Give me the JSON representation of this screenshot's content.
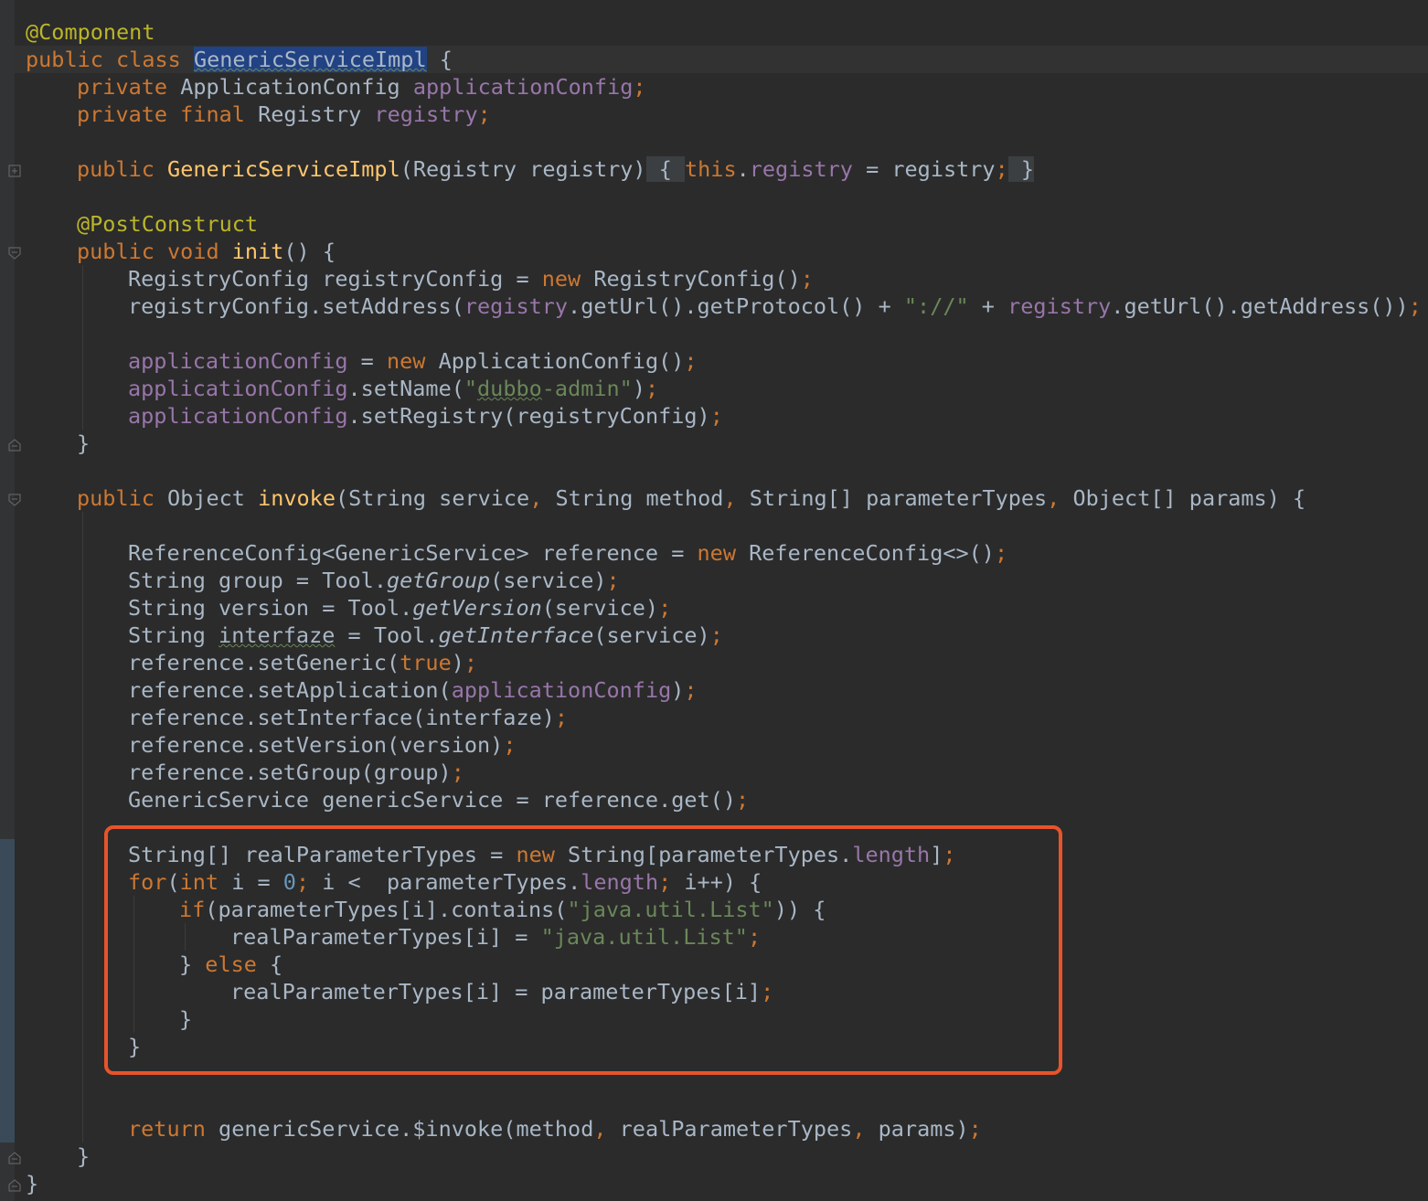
{
  "editor": {
    "lines": {
      "l1_annotation": "@Component",
      "l2_public_class": "public class ",
      "l2_class_name": "GenericServiceImpl",
      "l2_brace": " {",
      "l3_private": "private ",
      "l3_type": "ApplicationConfig ",
      "l3_field": "applicationConfig",
      "l3_semi": ";",
      "l4_private_final": "private final ",
      "l4_type": "Registry ",
      "l4_field": "registry",
      "l4_semi": ";",
      "l6_public": "public ",
      "l6_ctor": "GenericServiceImpl",
      "l6_params": "(Registry registry)",
      "l6_open": " { ",
      "l6_this": "this",
      "l6_dot": ".",
      "l6_field": "registry",
      "l6_assign": " = registry",
      "l6_semi": ";",
      "l6_close": " }",
      "l8_annotation": "@PostConstruct",
      "l9_public_void": "public void ",
      "l9_method": "init",
      "l9_rest": "() {",
      "l10_a": "RegistryConfig registryConfig = ",
      "l10_new": "new ",
      "l10_b": "RegistryConfig()",
      "l10_semi": ";",
      "l11_a": "registryConfig.setAddress(",
      "l11_f1": "registry",
      "l11_b": ".getUrl().getProtocol() + ",
      "l11_str": "\"://\"",
      "l11_c": " + ",
      "l11_f2": "registry",
      "l11_d": ".getUrl().getAddress())",
      "l11_semi": ";",
      "l13_field": "applicationConfig",
      "l13_a": " = ",
      "l13_new": "new ",
      "l13_b": "ApplicationConfig()",
      "l13_semi": ";",
      "l14_field": "applicationConfig",
      "l14_a": ".setName(",
      "l14_q1": "\"",
      "l14_wavy": "dubbo",
      "l14_q2": "-admin\"",
      "l14_b": ")",
      "l14_semi": ";",
      "l15_field": "applicationConfig",
      "l15_a": ".setRegistry(registryConfig)",
      "l15_semi": ";",
      "l16_close": "}",
      "l18_public": "public ",
      "l18_a": "Object ",
      "l18_method": "invoke",
      "l18_b": "(String service",
      "l18_c1": ", ",
      "l18_d": "String method",
      "l18_c2": ", ",
      "l18_e": "String[] parameterTypes",
      "l18_c3": ", ",
      "l18_f": "Object[] params) {",
      "l20_a": "ReferenceConfig<GenericService> reference = ",
      "l20_new": "new ",
      "l20_b": "ReferenceConfig<>()",
      "l20_semi": ";",
      "l21_a": "String group = Tool.",
      "l21_m": "getGroup",
      "l21_b": "(service)",
      "l21_semi": ";",
      "l22_a": "String version = Tool.",
      "l22_m": "getVersion",
      "l22_b": "(service)",
      "l22_semi": ";",
      "l23_a": "String ",
      "l23_wavy": "interfaze",
      "l23_b": " = Tool.",
      "l23_m": "getInterface",
      "l23_c": "(service)",
      "l23_semi": ";",
      "l24_a": "reference.setGeneric(",
      "l24_kw": "true",
      "l24_b": ")",
      "l24_semi": ";",
      "l25_a": "reference.setApplication(",
      "l25_field": "applicationConfig",
      "l25_b": ")",
      "l25_semi": ";",
      "l26_a": "reference.setInterface(interfaze)",
      "l26_semi": ";",
      "l27_a": "reference.setVersion(version)",
      "l27_semi": ";",
      "l28_a": "reference.setGroup(group)",
      "l28_semi": ";",
      "l29_a": "GenericService genericService = reference.get()",
      "l29_semi": ";",
      "l31_a": "String[] realParameterTypes = ",
      "l31_new": "new ",
      "l31_b": "String[parameterTypes.",
      "l31_field": "length",
      "l31_c": "]",
      "l31_semi": ";",
      "l32_for": "for",
      "l32_a": "(",
      "l32_int": "int ",
      "l32_b": "i = ",
      "l32_num": "0",
      "l32_s1": "; ",
      "l32_c": "i <  parameterTypes.",
      "l32_field": "length",
      "l32_s2": "; ",
      "l32_d": "i++) {",
      "l33_if": "if",
      "l33_a": "(parameterTypes[i].contains(",
      "l33_str": "\"java.util.List\"",
      "l33_b": ")) {",
      "l34_a": "realParameterTypes[i] = ",
      "l34_str": "\"java.util.List\"",
      "l34_semi": ";",
      "l35_a": "} ",
      "l35_else": "else ",
      "l35_b": "{",
      "l36_a": "realParameterTypes[i] = parameterTypes[i]",
      "l36_semi": ";",
      "l37_close": "}",
      "l38_close": "}",
      "l41_return": "return ",
      "l41_a": "genericService.$invoke(method",
      "l41_c1": ", ",
      "l41_b": "realParameterTypes",
      "l41_c2": ", ",
      "l41_c": "params)",
      "l41_semi": ";",
      "l42_close": "}",
      "l43_close": "}"
    }
  },
  "colors": {
    "background": "#2b2b2b",
    "keyword": "#cc7832",
    "annotation": "#bbb529",
    "field": "#9876aa",
    "method_decl": "#ffc66d",
    "string": "#6a8759",
    "number": "#6897bb",
    "highlight_box": "#e8542a"
  }
}
